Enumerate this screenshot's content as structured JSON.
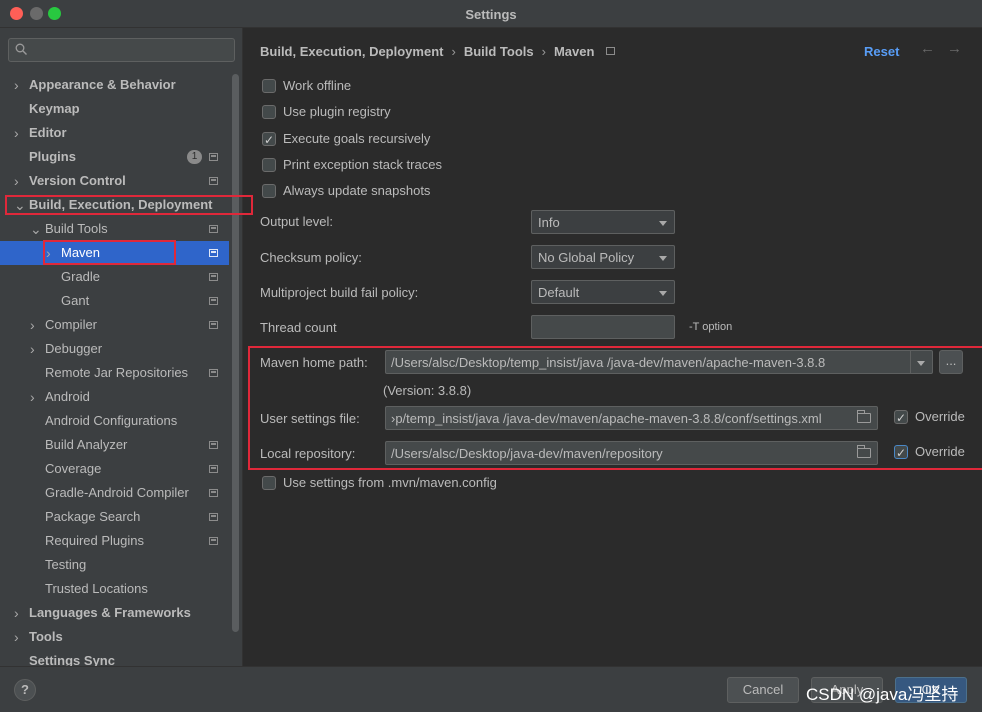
{
  "window": {
    "title": "Settings"
  },
  "search": {
    "placeholder": ""
  },
  "sidebar": {
    "items": [
      {
        "label": "Appearance & Behavior",
        "chevron": "›",
        "badge": "",
        "proj": false
      },
      {
        "label": "Keymap",
        "chevron": "",
        "badge": "",
        "proj": false
      },
      {
        "label": "Editor",
        "chevron": "›",
        "badge": "",
        "proj": false
      },
      {
        "label": "Plugins",
        "chevron": "",
        "badge": "1",
        "proj": true
      },
      {
        "label": "Version Control",
        "chevron": "›",
        "badge": "",
        "proj": true
      },
      {
        "label": "Build, Execution, Deployment",
        "chevron": "⌄",
        "badge": "",
        "proj": false
      },
      {
        "label": "Build Tools",
        "chevron": "⌄",
        "badge": "",
        "proj": true
      },
      {
        "label": "Maven",
        "chevron": "›",
        "badge": "",
        "proj": true
      },
      {
        "label": "Gradle",
        "chevron": "",
        "badge": "",
        "proj": true
      },
      {
        "label": "Gant",
        "chevron": "",
        "badge": "",
        "proj": true
      },
      {
        "label": "Compiler",
        "chevron": "›",
        "badge": "",
        "proj": true
      },
      {
        "label": "Debugger",
        "chevron": "›",
        "badge": "",
        "proj": false
      },
      {
        "label": "Remote Jar Repositories",
        "chevron": "",
        "badge": "",
        "proj": true
      },
      {
        "label": "Android",
        "chevron": "›",
        "badge": "",
        "proj": false
      },
      {
        "label": "Android Configurations",
        "chevron": "",
        "badge": "",
        "proj": false
      },
      {
        "label": "Build Analyzer",
        "chevron": "",
        "badge": "",
        "proj": true
      },
      {
        "label": "Coverage",
        "chevron": "",
        "badge": "",
        "proj": true
      },
      {
        "label": "Gradle-Android Compiler",
        "chevron": "",
        "badge": "",
        "proj": true
      },
      {
        "label": "Package Search",
        "chevron": "",
        "badge": "",
        "proj": true
      },
      {
        "label": "Required Plugins",
        "chevron": "",
        "badge": "",
        "proj": true
      },
      {
        "label": "Testing",
        "chevron": "",
        "badge": "",
        "proj": false
      },
      {
        "label": "Trusted Locations",
        "chevron": "",
        "badge": "",
        "proj": false
      },
      {
        "label": "Languages & Frameworks",
        "chevron": "›",
        "badge": "",
        "proj": false
      },
      {
        "label": "Tools",
        "chevron": "›",
        "badge": "",
        "proj": false
      },
      {
        "label": "Settings Sync",
        "chevron": "",
        "badge": "",
        "proj": false
      }
    ]
  },
  "breadcrumb": {
    "part1": "Build, Execution, Deployment",
    "part2": "Build Tools",
    "part3": "Maven",
    "sep": "›"
  },
  "header": {
    "reset": "Reset",
    "back": "←",
    "forward": "→"
  },
  "options": {
    "work_offline": {
      "label": "Work offline",
      "checked": false
    },
    "use_plugin_registry": {
      "label": "Use plugin registry",
      "checked": false
    },
    "execute_goals_recursively": {
      "label": "Execute goals recursively",
      "checked": true
    },
    "print_exception_stack_traces": {
      "label": "Print exception stack traces",
      "checked": false
    },
    "always_update_snapshots": {
      "label": "Always update snapshots",
      "checked": false
    }
  },
  "form": {
    "output_level": {
      "label": "Output level:",
      "value": "Info"
    },
    "checksum_policy": {
      "label": "Checksum policy:",
      "value": "No Global Policy"
    },
    "multiproject_fail_policy": {
      "label": "Multiproject build fail policy:",
      "value": "Default"
    },
    "thread_count": {
      "label": "Thread count",
      "value": "",
      "hint": "-T option"
    },
    "maven_home": {
      "label": "Maven home path:",
      "value": "/Users/alsc/Desktop/temp_insist/java /java-dev/maven/apache-maven-3.8.8",
      "browse": "...",
      "version": "(Version: 3.8.8)"
    },
    "user_settings": {
      "label": "User settings file:",
      "value": "›p/temp_insist/java /java-dev/maven/apache-maven-3.8.8/conf/settings.xml",
      "override_label": "Override",
      "override_checked": true
    },
    "local_repo": {
      "label": "Local repository:",
      "value": "/Users/alsc/Desktop/java-dev/maven/repository",
      "override_label": "Override",
      "override_checked": true
    },
    "use_mvn_config": {
      "label": "Use settings from .mvn/maven.config",
      "checked": false
    }
  },
  "footer": {
    "help": "?",
    "cancel": "Cancel",
    "apply": "Apply",
    "ok": "OK"
  },
  "watermark": "CSDN @java冯坚持"
}
